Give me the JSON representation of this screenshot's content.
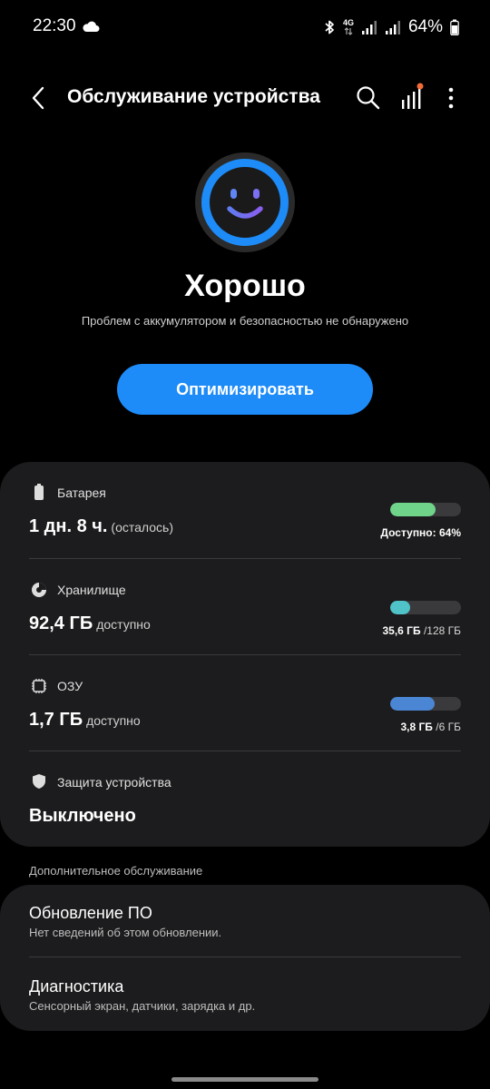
{
  "status_bar": {
    "time": "22:30",
    "battery_percent": "64%",
    "network_type": "4G",
    "icons": [
      "cloud-icon",
      "bluetooth-icon",
      "signal-icon",
      "signal-icon",
      "battery-icon"
    ]
  },
  "app_bar": {
    "title": "Обслуживание устройства",
    "icons": [
      "back-arrow-icon",
      "search-icon",
      "bar-chart-icon",
      "more-vertical-icon"
    ]
  },
  "hero": {
    "status": "Хорошо",
    "message": "Проблем с аккумулятором и безопасностью не обнаружено",
    "optimize_label": "Оптимизировать",
    "accent_color": "#1d8cf8"
  },
  "battery": {
    "label": "Батарея",
    "value": "1 дн. 8 ч.",
    "value_suffix": "(осталось)",
    "caption": "Доступно: 64%",
    "level": 0.64,
    "color": "#6fd38a"
  },
  "storage": {
    "label": "Хранилище",
    "value": "92,4 ГБ",
    "value_suffix": "доступно",
    "used": "35,6 ГБ",
    "total": "/128 ГБ",
    "level": 0.28,
    "color": "#4fc3c8"
  },
  "ram": {
    "label": "ОЗУ",
    "value": "1,7 ГБ",
    "value_suffix": "доступно",
    "used": "3,8 ГБ",
    "total": "/6 ГБ",
    "level": 0.63,
    "color": "#4a86d4"
  },
  "security": {
    "label": "Защита устройства",
    "value": "Выключено"
  },
  "extra": {
    "header": "Дополнительное обслуживание",
    "items": [
      {
        "title": "Обновление ПО",
        "subtitle": "Нет сведений об этом обновлении."
      },
      {
        "title": "Диагностика",
        "subtitle": "Сенсорный экран, датчики, зарядка и др."
      }
    ]
  }
}
